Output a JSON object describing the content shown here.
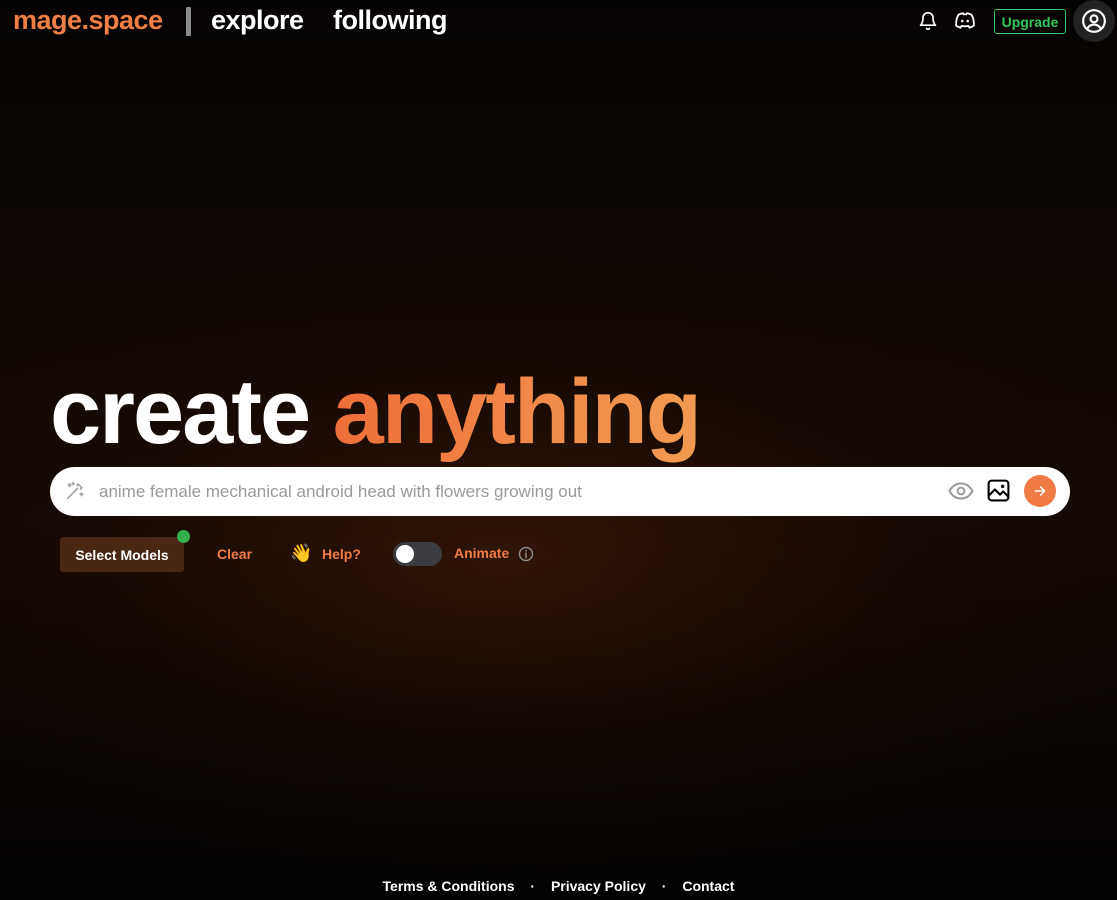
{
  "nav": {
    "brand": "mage.space",
    "links": [
      "explore",
      "following"
    ],
    "upgrade_label": "Upgrade",
    "icons": [
      "bell-icon",
      "discord-icon",
      "user-circle-icon"
    ]
  },
  "hero": {
    "word1": "create",
    "word2": "anything"
  },
  "prompt": {
    "placeholder": "anime female mechanical android head with flowers growing out",
    "value": "",
    "icons": [
      "magic-wand-icon",
      "eye-icon",
      "image-icon",
      "arrow-right-icon"
    ]
  },
  "controls": {
    "select_models_label": "Select Models",
    "clear_label": "Clear",
    "help_emoji": "👋",
    "help_label": "Help?",
    "animate_label": "Animate",
    "animate_on": false
  },
  "footer": {
    "links": [
      "Terms & Conditions",
      "Privacy Policy",
      "Contact"
    ],
    "separator": "·"
  },
  "colors": {
    "accent": "#f07b44",
    "upgrade": "#34c759",
    "status_dot": "#34b04a",
    "select_models_bg": "#4a2614"
  }
}
